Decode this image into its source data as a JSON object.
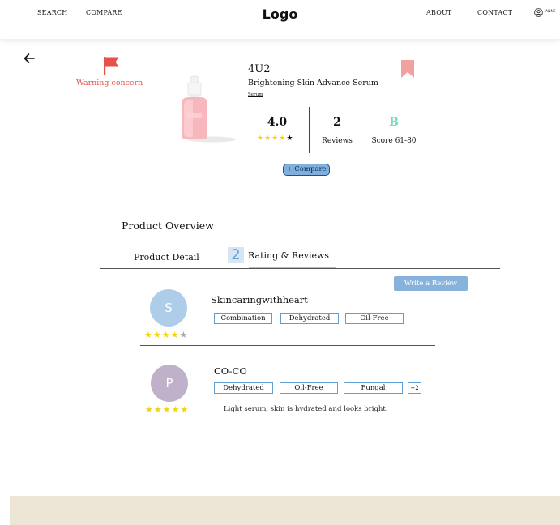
{
  "nav": {
    "search": "SEARCH",
    "compare": "COMPARE",
    "logo": "Logo",
    "about": "ABOUT",
    "contact": "CONTACT",
    "user": "ANNE"
  },
  "product": {
    "warning": "Warning concern",
    "brand": "4U2",
    "name": "Brightening Skin Advance Serum",
    "category": "Serum",
    "rating": "4.0",
    "rating_stars": 4,
    "reviews_count": "2",
    "reviews_label": "Reviews",
    "grade": "B",
    "score_label": "Score 61-80",
    "compare_label": "+ Compare"
  },
  "overview": {
    "title": "Product Overview",
    "tabs": [
      {
        "label": "Product Detail"
      },
      {
        "label": "Rating & Reviews",
        "count": "2"
      }
    ],
    "write_review": "Write a Review"
  },
  "reviews": [
    {
      "initial": "S",
      "avatar_color": "#aecde9",
      "name": "Skincaringwithheart",
      "stars": 4,
      "tags": [
        "Combination",
        "Dehydrated",
        "Oil-Free"
      ],
      "text": ""
    },
    {
      "initial": "P",
      "avatar_color": "#bfb1c9",
      "name": "CO-CO",
      "stars": 5,
      "tags": [
        "Dehydrated",
        "Oil-Free",
        "Fungal"
      ],
      "more_tags": "+2",
      "text": "Light serum, skin is hydrated and looks bright."
    }
  ],
  "colors": {
    "star_filled": "#f4d40b",
    "star_empty": "#a9a9a9",
    "warning": "#e8504b",
    "bookmark": "#f2a1a1",
    "grade": "#6ee0b2",
    "footer": "#ede6d6"
  }
}
